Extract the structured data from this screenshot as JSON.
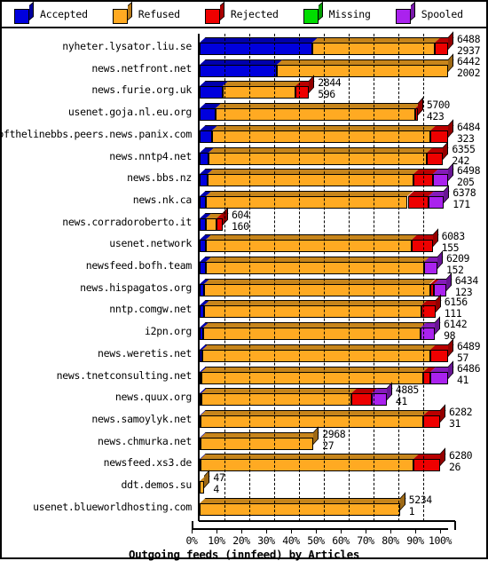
{
  "legend": {
    "items": [
      {
        "label": "Accepted",
        "color": "#0000dd",
        "icon": "cube-icon"
      },
      {
        "label": "Refused",
        "color": "#ffaa22",
        "icon": "cube-icon"
      },
      {
        "label": "Rejected",
        "color": "#ee0000",
        "icon": "cube-icon"
      },
      {
        "label": "Missing",
        "color": "#00dd00",
        "icon": "cube-icon"
      },
      {
        "label": "Spooled",
        "color": "#aa22ee",
        "icon": "cube-icon"
      }
    ]
  },
  "axis": {
    "title": "Outgoing feeds (innfeed) by Articles",
    "ticks": [
      "0%",
      "10%",
      "20%",
      "30%",
      "40%",
      "50%",
      "60%",
      "70%",
      "80%",
      "90%",
      "100%"
    ]
  },
  "chart_data": {
    "type": "bar",
    "title": "Outgoing feeds (innfeed) by Articles",
    "orientation": "horizontal",
    "stacked": true,
    "normalized": true,
    "xlabel": "Outgoing feeds (innfeed) by Articles",
    "ylabel": "",
    "xlim": [
      0,
      100
    ],
    "xunit": "%",
    "grid": true,
    "legend_position": "top",
    "series": [
      {
        "name": "Accepted",
        "color": "#0000dd"
      },
      {
        "name": "Refused",
        "color": "#ffaa22"
      },
      {
        "name": "Rejected",
        "color": "#ee0000"
      },
      {
        "name": "Missing",
        "color": "#00dd00"
      },
      {
        "name": "Spooled",
        "color": "#aa22ee"
      }
    ],
    "categories": [
      "nyheter.lysator.liu.se",
      "news.netfront.net",
      "news.furie.org.uk",
      "usenet.goja.nl.eu.org",
      "endofthelinebbs.peers.news.panix.com",
      "news.nntp4.net",
      "news.bbs.nz",
      "news.nk.ca",
      "news.corradoroberto.it",
      "usenet.network",
      "newsfeed.bofh.team",
      "news.hispagatos.org",
      "nntp.comgw.net",
      "i2pn.org",
      "news.weretis.net",
      "news.tnetconsulting.net",
      "news.quux.org",
      "news.samoylyk.net",
      "news.chmurka.net",
      "newsfeed.xs3.de",
      "ddt.demos.su",
      "usenet.blueworldhosting.com"
    ],
    "rows": [
      {
        "label": "nyheter.lysator.liu.se",
        "total": 6488,
        "secondary": 2937,
        "bar_pct": 100.0,
        "segments": [
          {
            "s": "Accepted",
            "pct": 45.3
          },
          {
            "s": "Refused",
            "pct": 49.2
          },
          {
            "s": "Rejected",
            "pct": 5.5
          }
        ]
      },
      {
        "label": "news.netfront.net",
        "total": 6442,
        "secondary": 2002,
        "bar_pct": 100.0,
        "segments": [
          {
            "s": "Accepted",
            "pct": 31.1
          },
          {
            "s": "Refused",
            "pct": 68.9
          }
        ]
      },
      {
        "label": "news.furie.org.uk",
        "total": 2844,
        "secondary": 596,
        "bar_pct": 44.0,
        "segments": [
          {
            "s": "Accepted",
            "pct": 20.9
          },
          {
            "s": "Refused",
            "pct": 67.0
          },
          {
            "s": "Rejected",
            "pct": 12.1
          }
        ]
      },
      {
        "label": "usenet.goja.nl.eu.org",
        "total": 5700,
        "secondary": 423,
        "bar_pct": 87.8,
        "segments": [
          {
            "s": "Accepted",
            "pct": 7.4
          },
          {
            "s": "Refused",
            "pct": 91.4
          },
          {
            "s": "Rejected",
            "pct": 1.2
          }
        ]
      },
      {
        "label": "endofthelinebbs.peers.news.panix.com",
        "total": 6484,
        "secondary": 323,
        "bar_pct": 100.0,
        "segments": [
          {
            "s": "Accepted",
            "pct": 5.0
          },
          {
            "s": "Refused",
            "pct": 88.0
          },
          {
            "s": "Rejected",
            "pct": 7.0
          }
        ]
      },
      {
        "label": "news.nntp4.net",
        "total": 6355,
        "secondary": 242,
        "bar_pct": 98.0,
        "segments": [
          {
            "s": "Accepted",
            "pct": 3.8
          },
          {
            "s": "Refused",
            "pct": 89.5
          },
          {
            "s": "Rejected",
            "pct": 6.7
          }
        ]
      },
      {
        "label": "news.bbs.nz",
        "total": 6498,
        "secondary": 205,
        "bar_pct": 100.0,
        "segments": [
          {
            "s": "Accepted",
            "pct": 3.2
          },
          {
            "s": "Refused",
            "pct": 82.8
          },
          {
            "s": "Rejected",
            "pct": 8.0
          },
          {
            "s": "Spooled",
            "pct": 6.0
          }
        ]
      },
      {
        "label": "news.nk.ca",
        "total": 6378,
        "secondary": 171,
        "bar_pct": 98.3,
        "segments": [
          {
            "s": "Accepted",
            "pct": 2.7
          },
          {
            "s": "Refused",
            "pct": 82.5
          },
          {
            "s": "Rejected",
            "pct": 8.5
          },
          {
            "s": "Spooled",
            "pct": 6.3
          }
        ]
      },
      {
        "label": "news.corradoroberto.it",
        "total": 604,
        "secondary": 160,
        "bar_pct": 9.3,
        "segments": [
          {
            "s": "Accepted",
            "pct": 26.5
          },
          {
            "s": "Refused",
            "pct": 47.0
          },
          {
            "s": "Rejected",
            "pct": 26.5
          }
        ]
      },
      {
        "label": "usenet.network",
        "total": 6083,
        "secondary": 155,
        "bar_pct": 93.8,
        "segments": [
          {
            "s": "Accepted",
            "pct": 2.6
          },
          {
            "s": "Refused",
            "pct": 88.4
          },
          {
            "s": "Rejected",
            "pct": 9.0
          }
        ]
      },
      {
        "label": "newsfeed.bofh.team",
        "total": 6209,
        "secondary": 152,
        "bar_pct": 95.7,
        "segments": [
          {
            "s": "Accepted",
            "pct": 2.5
          },
          {
            "s": "Refused",
            "pct": 92.0
          },
          {
            "s": "Spooled",
            "pct": 5.5
          }
        ]
      },
      {
        "label": "news.hispagatos.org",
        "total": 6434,
        "secondary": 123,
        "bar_pct": 99.2,
        "segments": [
          {
            "s": "Accepted",
            "pct": 1.9
          },
          {
            "s": "Refused",
            "pct": 91.6
          },
          {
            "s": "Rejected",
            "pct": 1.5
          },
          {
            "s": "Spooled",
            "pct": 5.0
          }
        ]
      },
      {
        "label": "nntp.comgw.net",
        "total": 6156,
        "secondary": 111,
        "bar_pct": 94.9,
        "segments": [
          {
            "s": "Accepted",
            "pct": 1.8
          },
          {
            "s": "Refused",
            "pct": 92.2
          },
          {
            "s": "Rejected",
            "pct": 6.0
          }
        ]
      },
      {
        "label": "i2pn.org",
        "total": 6142,
        "secondary": 98,
        "bar_pct": 94.7,
        "segments": [
          {
            "s": "Accepted",
            "pct": 1.6
          },
          {
            "s": "Refused",
            "pct": 92.4
          },
          {
            "s": "Spooled",
            "pct": 6.0
          }
        ]
      },
      {
        "label": "news.weretis.net",
        "total": 6489,
        "secondary": 57,
        "bar_pct": 100.0,
        "segments": [
          {
            "s": "Accepted",
            "pct": 0.9
          },
          {
            "s": "Refused",
            "pct": 92.1
          },
          {
            "s": "Rejected",
            "pct": 7.0
          }
        ]
      },
      {
        "label": "news.tnetconsulting.net",
        "total": 6486,
        "secondary": 41,
        "bar_pct": 100.0,
        "segments": [
          {
            "s": "Accepted",
            "pct": 0.6
          },
          {
            "s": "Refused",
            "pct": 89.4
          },
          {
            "s": "Rejected",
            "pct": 3.0
          },
          {
            "s": "Spooled",
            "pct": 7.0
          }
        ]
      },
      {
        "label": "news.quux.org",
        "total": 4885,
        "secondary": 41,
        "bar_pct": 75.3,
        "segments": [
          {
            "s": "Accepted",
            "pct": 0.8
          },
          {
            "s": "Refused",
            "pct": 80.2
          },
          {
            "s": "Rejected",
            "pct": 11.0
          },
          {
            "s": "Spooled",
            "pct": 8.0
          }
        ]
      },
      {
        "label": "news.samoylyk.net",
        "total": 6282,
        "secondary": 31,
        "bar_pct": 96.8,
        "segments": [
          {
            "s": "Accepted",
            "pct": 0.5
          },
          {
            "s": "Refused",
            "pct": 92.5
          },
          {
            "s": "Rejected",
            "pct": 7.0
          }
        ]
      },
      {
        "label": "news.chmurka.net",
        "total": 2968,
        "secondary": 27,
        "bar_pct": 45.8,
        "segments": [
          {
            "s": "Accepted",
            "pct": 0.9
          },
          {
            "s": "Refused",
            "pct": 99.1
          }
        ]
      },
      {
        "label": "newsfeed.xs3.de",
        "total": 6280,
        "secondary": 26,
        "bar_pct": 96.8,
        "segments": [
          {
            "s": "Accepted",
            "pct": 0.4
          },
          {
            "s": "Refused",
            "pct": 88.6
          },
          {
            "s": "Rejected",
            "pct": 11.0
          }
        ]
      },
      {
        "label": "ddt.demos.su",
        "total": 47,
        "secondary": 4,
        "bar_pct": 1.9,
        "segments": [
          {
            "s": "Refused",
            "pct": 100.0
          }
        ]
      },
      {
        "label": "usenet.blueworldhosting.com",
        "total": 5234,
        "secondary": 1,
        "bar_pct": 80.6,
        "segments": [
          {
            "s": "Refused",
            "pct": 100.0
          }
        ]
      }
    ]
  }
}
